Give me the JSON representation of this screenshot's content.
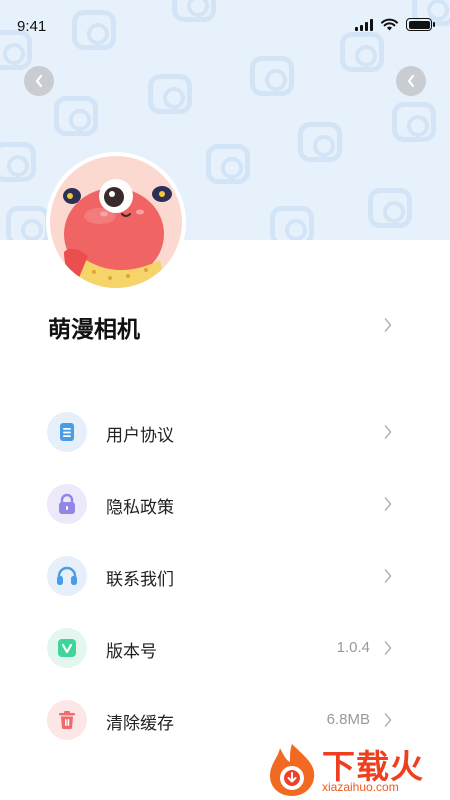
{
  "status_bar": {
    "time": "9:41"
  },
  "app": {
    "name": "萌漫相机"
  },
  "menu": [
    {
      "label": "用户协议",
      "value": "",
      "icon": "document-icon",
      "icon_bg": "#e6f0fb",
      "icon_color": "#4a9be8"
    },
    {
      "label": "隐私政策",
      "value": "",
      "icon": "lock-icon",
      "icon_bg": "#ebe9fa",
      "icon_color": "#8f86e6"
    },
    {
      "label": "联系我们",
      "value": "",
      "icon": "headset-icon",
      "icon_bg": "#e6f0fb",
      "icon_color": "#4a9be8"
    },
    {
      "label": "版本号",
      "value": "1.0.4",
      "icon": "version-icon",
      "icon_bg": "#e3f7ee",
      "icon_color": "#3dd59a"
    },
    {
      "label": "清除缓存",
      "value": "6.8MB",
      "icon": "trash-icon",
      "icon_bg": "#fde6e6",
      "icon_color": "#f06a6a"
    }
  ],
  "watermark": {
    "title": "下载火",
    "subtitle": "xiazaihuo.com"
  },
  "colors": {
    "header_bg": "#e6f1fc",
    "chevron": "#b5b5b5"
  }
}
